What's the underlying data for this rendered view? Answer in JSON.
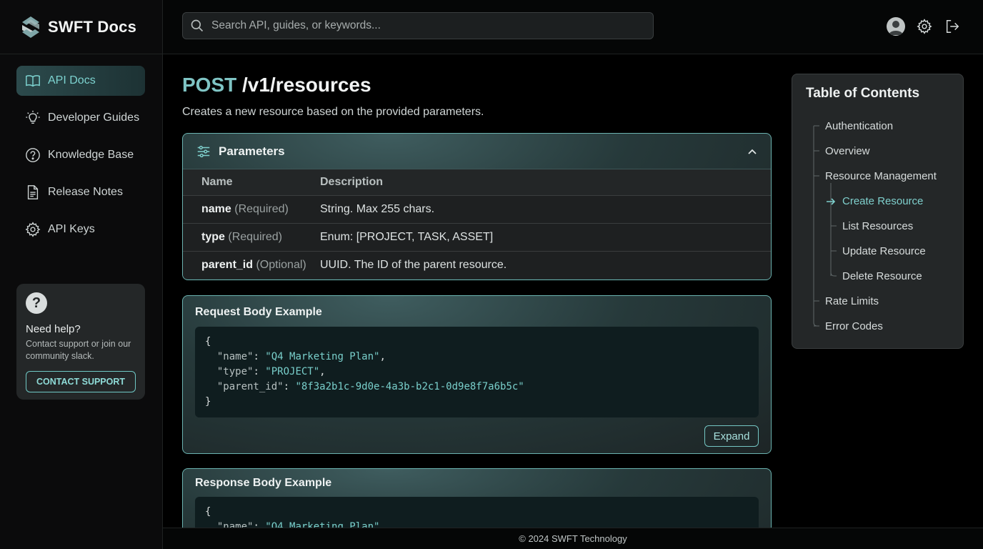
{
  "app": {
    "name": "SWFT Docs"
  },
  "sidebar": {
    "items": [
      {
        "label": "API Docs",
        "icon": "book-icon",
        "active": true
      },
      {
        "label": "Developer Guides",
        "icon": "lightbulb-icon",
        "active": false
      },
      {
        "label": "Knowledge Base",
        "icon": "question-circle-icon",
        "active": false
      },
      {
        "label": "Release Notes",
        "icon": "document-icon",
        "active": false
      },
      {
        "label": "API Keys",
        "icon": "gear-icon",
        "active": false
      }
    ],
    "help": {
      "icon": "question-icon",
      "title": "Need help?",
      "text": "Contact support or join our community slack.",
      "button": "CONTACT SUPPORT"
    }
  },
  "header": {
    "search_placeholder": "Search API, guides, or keywords...",
    "icons": [
      "user-avatar-icon",
      "settings-gear-icon",
      "logout-icon"
    ]
  },
  "main": {
    "method": "POST",
    "path": "/v1/resources",
    "description": "Creates a new resource based on the provided parameters.",
    "parameters": {
      "title": "Parameters",
      "columns": [
        "Name",
        "Description"
      ],
      "rows": [
        {
          "name": "name",
          "req": "(Required)",
          "desc": "String. Max 255 chars."
        },
        {
          "name": "type",
          "req": "(Required)",
          "desc": "Enum: [PROJECT, TASK, ASSET]"
        },
        {
          "name": "parent_id",
          "req": "(Optional)",
          "desc": "UUID. The ID of the parent resource."
        }
      ]
    },
    "request": {
      "title": "Request Body Example",
      "code": {
        "open": "{",
        "lines": [
          {
            "key": "\"name\"",
            "value": "\"Q4 Marketing Plan\"",
            "comma": ","
          },
          {
            "key": "\"type\"",
            "value": "\"PROJECT\"",
            "comma": ","
          },
          {
            "key": "\"parent_id\"",
            "value": "\"8f3a2b1c-9d0e-4a3b-b2c1-0d9e8f7a6b5c\"",
            "comma": ""
          }
        ],
        "close": "}"
      },
      "expand_label": "Expand"
    },
    "response": {
      "title": "Response Body Example",
      "code": {
        "open": "{",
        "lines": [
          {
            "key": "\"name\"",
            "value": "\"Q4 Marketing Plan\"",
            "comma": ","
          }
        ]
      }
    }
  },
  "toc": {
    "title": "Table of Contents",
    "items": [
      {
        "label": "Authentication"
      },
      {
        "label": "Overview"
      },
      {
        "label": "Resource Management"
      },
      {
        "label": "Create Resource",
        "active": true
      },
      {
        "label": "List Resources"
      },
      {
        "label": "Update Resource"
      },
      {
        "label": "Delete Resource"
      },
      {
        "label": "Rate Limits"
      },
      {
        "label": "Error Codes"
      }
    ]
  },
  "footer": {
    "text": "© 2024 SWFT Technology"
  },
  "colors": {
    "accent": "#7fc4c4",
    "accent_border": "#6bb3b0",
    "background": "#000000"
  }
}
